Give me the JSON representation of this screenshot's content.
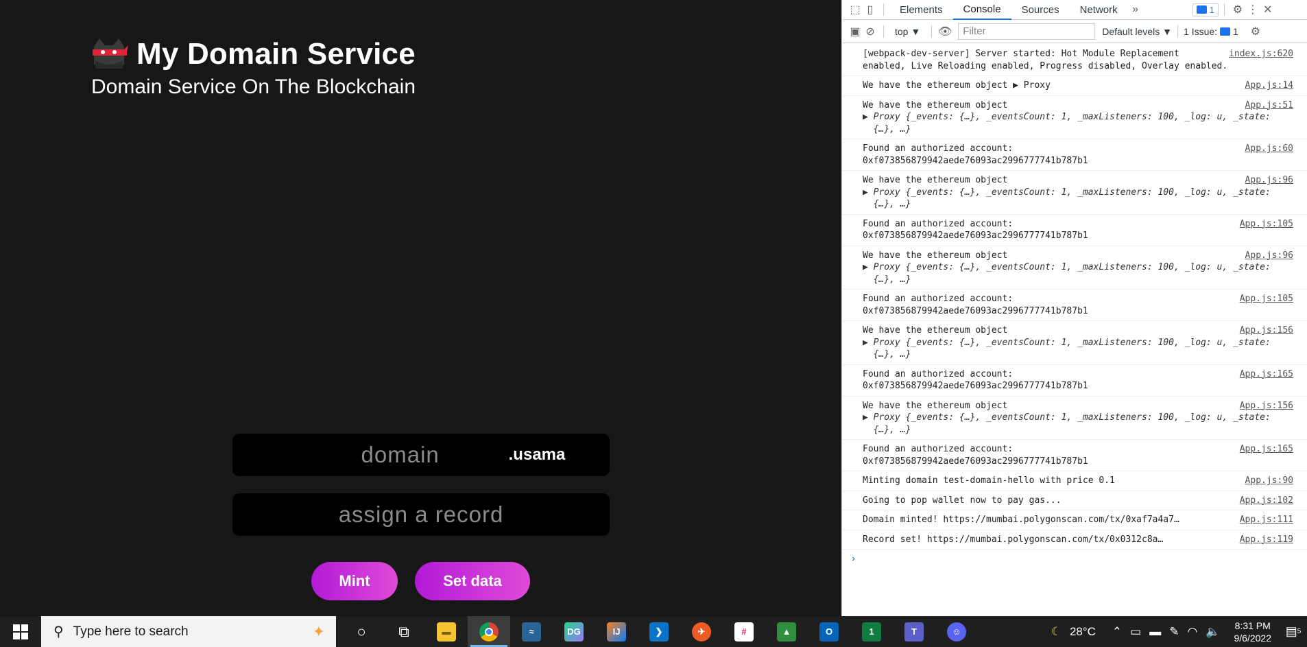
{
  "app": {
    "title": "My Domain Service",
    "subtitle": "Domain Service On The Blockchain",
    "domain_placeholder": "domain",
    "tld": ".usama",
    "record_placeholder": "assign a record",
    "mint_label": "Mint",
    "setdata_label": "Set data"
  },
  "devtools": {
    "tabs": [
      "Elements",
      "Console",
      "Sources",
      "Network"
    ],
    "active_tab": "Console",
    "more": "»",
    "issues_badge": "1",
    "context": "top ▼",
    "filter_placeholder": "Filter",
    "levels": "Default levels ▼",
    "issue_label": "1 Issue:",
    "issue_count": "1",
    "messages": [
      {
        "lines": [
          "[webpack-dev-server] Server started: Hot Module Replacement",
          "enabled, Live Reloading enabled, Progress disabled, Overlay enabled."
        ],
        "src": "index.js:620"
      },
      {
        "lines": [
          "We have the ethereum object ▶ Proxy"
        ],
        "src": "App.js:14"
      },
      {
        "lines": [
          "We have the ethereum object",
          "▶ Proxy {_events: {…}, _eventsCount: 1, _maxListeners: 100, _log: u, _state:",
          "  {…}, …}"
        ],
        "src": "App.js:51"
      },
      {
        "lines": [
          "Found an authorized account:",
          "0xf073856879942aede76093ac2996777741b787b1"
        ],
        "src": "App.js:60"
      },
      {
        "lines": [
          "We have the ethereum object",
          "▶ Proxy {_events: {…}, _eventsCount: 1, _maxListeners: 100, _log: u, _state:",
          "  {…}, …}"
        ],
        "src": "App.js:96"
      },
      {
        "lines": [
          "Found an authorized account:",
          "0xf073856879942aede76093ac2996777741b787b1"
        ],
        "src": "App.js:105"
      },
      {
        "lines": [
          "We have the ethereum object",
          "▶ Proxy {_events: {…}, _eventsCount: 1, _maxListeners: 100, _log: u, _state:",
          "  {…}, …}"
        ],
        "src": "App.js:96"
      },
      {
        "lines": [
          "Found an authorized account:",
          "0xf073856879942aede76093ac2996777741b787b1"
        ],
        "src": "App.js:105"
      },
      {
        "lines": [
          "We have the ethereum object",
          "▶ Proxy {_events: {…}, _eventsCount: 1, _maxListeners: 100, _log: u, _state:",
          "  {…}, …}"
        ],
        "src": "App.js:156"
      },
      {
        "lines": [
          "Found an authorized account:",
          "0xf073856879942aede76093ac2996777741b787b1"
        ],
        "src": "App.js:165"
      },
      {
        "lines": [
          "We have the ethereum object",
          "▶ Proxy {_events: {…}, _eventsCount: 1, _maxListeners: 100, _log: u, _state:",
          "  {…}, …}"
        ],
        "src": "App.js:156"
      },
      {
        "lines": [
          "Found an authorized account:",
          "0xf073856879942aede76093ac2996777741b787b1"
        ],
        "src": "App.js:165"
      },
      {
        "lines": [
          "Minting domain test-domain-hello with price 0.1"
        ],
        "src": "App.js:90"
      },
      {
        "lines": [
          "Going to pop wallet now to pay gas..."
        ],
        "src": "App.js:102"
      },
      {
        "lines": [
          "Domain minted! https://mumbai.polygonscan.com/tx/0xaf7a4a7…"
        ],
        "src": "App.js:111"
      },
      {
        "lines": [
          "Record set! https://mumbai.polygonscan.com/tx/0x0312c8a…"
        ],
        "src": "App.js:119"
      }
    ],
    "prompt": "›"
  },
  "taskbar": {
    "search_placeholder": "Type here to search",
    "weather": "28°C",
    "time": "8:31 PM",
    "date": "9/6/2022",
    "notifications": "5"
  }
}
